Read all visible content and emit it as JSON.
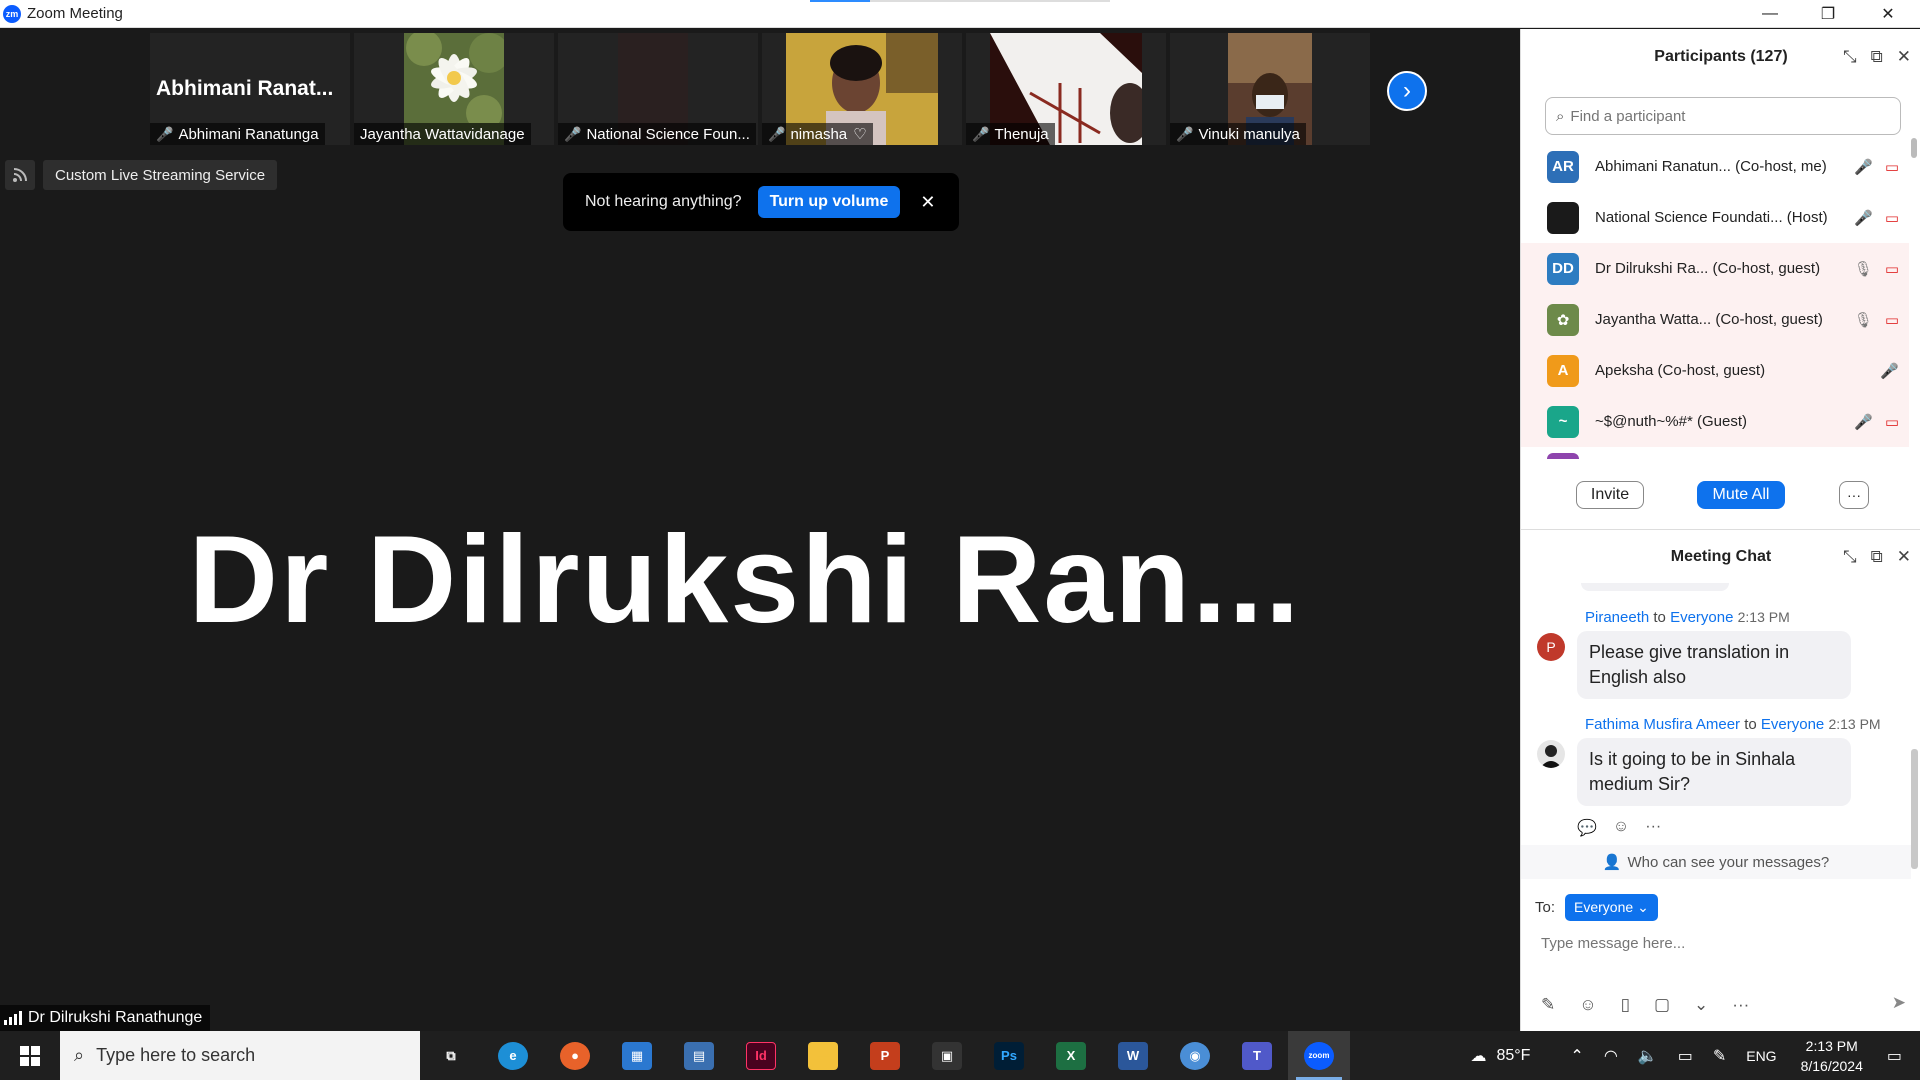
{
  "window": {
    "logo_text": "zm",
    "title": "Zoom Meeting",
    "minimize": "—",
    "restore": "❐",
    "close": "✕"
  },
  "gallery": {
    "thumbnails": [
      {
        "name": "Abhimani Ranatunga",
        "big_name": "Abhimani  Ranat...",
        "muted": true
      },
      {
        "name": "Jayantha Wattavidanage",
        "muted": false
      },
      {
        "name": "National Science Foun...",
        "muted": true
      },
      {
        "name": "nimasha",
        "muted": true
      },
      {
        "name": "Thenuja",
        "muted": true
      },
      {
        "name": "Vinuki manulya",
        "muted": true
      }
    ],
    "next_icon": "›",
    "heart_icon": "♡"
  },
  "stream": {
    "label": "Custom Live Streaming Service"
  },
  "audio_toast": {
    "message": "Not hearing anything?",
    "button": "Turn up volume",
    "close": "✕"
  },
  "speaker": {
    "big_name": "Dr  Dilrukshi  Ran...",
    "full_name": "Dr Dilrukshi Ranathunge"
  },
  "participants": {
    "title": "Participants (127)",
    "search_placeholder": "Find a participant",
    "list": [
      {
        "initials": "AR",
        "name": "Abhimani Ranatun... (Co-host, me)",
        "color": "#2d6fb7"
      },
      {
        "initials": "",
        "name": "National Science Foundati... (Host)",
        "color": "#1a1a1a"
      },
      {
        "initials": "DD",
        "name": "Dr Dilrukshi Ra...   (Co-host, guest)",
        "color": "#2d7cc1"
      },
      {
        "initials": "",
        "name": "Jayantha Watta...   (Co-host, guest)",
        "color": "#6d8a4a"
      },
      {
        "initials": "A",
        "name": "Apeksha (Co-host, guest)",
        "color": "#f09a1a"
      },
      {
        "initials": "~",
        "name": "~$@nuth~%#* (Guest)",
        "color": "#1aa68a"
      }
    ],
    "invite": "Invite",
    "mute_all": "Mute All",
    "more": "···"
  },
  "chat": {
    "title": "Meeting Chat",
    "messages": [
      {
        "sender": "Piraneeth",
        "to_label": "to",
        "recipient": "Everyone",
        "time": "2:13 PM",
        "text": "Please give translation in English also",
        "avatar": "P",
        "avatar_color": "#c0392b"
      },
      {
        "sender": "Fathima Musfira Ameer",
        "to_label": "to",
        "recipient": "Everyone",
        "time": "2:13 PM",
        "text": "Is it going to be in Sinhala medium Sir?",
        "avatar": "",
        "avatar_color": "#444"
      }
    ],
    "who_can_see": "Who can see your messages?",
    "to_label": "To:",
    "to_value": "Everyone",
    "input_placeholder": "Type message here..."
  },
  "taskbar": {
    "search_placeholder": "Type here to search",
    "weather": "85°F",
    "language": "ENG",
    "time": "2:13 PM",
    "date": "8/16/2024",
    "apps": [
      {
        "name": "task-view",
        "label": "⧉",
        "bg": "transparent"
      },
      {
        "name": "edge",
        "label": "e",
        "bg": "#1d8fd6"
      },
      {
        "name": "firefox",
        "label": "●",
        "bg": "#e8622a"
      },
      {
        "name": "store",
        "label": "▦",
        "bg": "#2b78d0"
      },
      {
        "name": "calculator",
        "label": "▤",
        "bg": "#3a6fb0"
      },
      {
        "name": "indesign",
        "label": "Id",
        "bg": "#49021f"
      },
      {
        "name": "file-explorer",
        "label": "▬",
        "bg": "#f3c13a"
      },
      {
        "name": "powerpoint",
        "label": "P",
        "bg": "#c43e1c"
      },
      {
        "name": "media-app",
        "label": "▣",
        "bg": "#333"
      },
      {
        "name": "photoshop",
        "label": "Ps",
        "bg": "#001e36"
      },
      {
        "name": "excel",
        "label": "X",
        "bg": "#1d6f42"
      },
      {
        "name": "word",
        "label": "W",
        "bg": "#2b579a"
      },
      {
        "name": "globe-app",
        "label": "◉",
        "bg": "#4a8ed6"
      },
      {
        "name": "teams",
        "label": "T",
        "bg": "#5059c9"
      },
      {
        "name": "zoom",
        "label": "zoom",
        "bg": "#0b5cff",
        "active": true
      }
    ]
  }
}
